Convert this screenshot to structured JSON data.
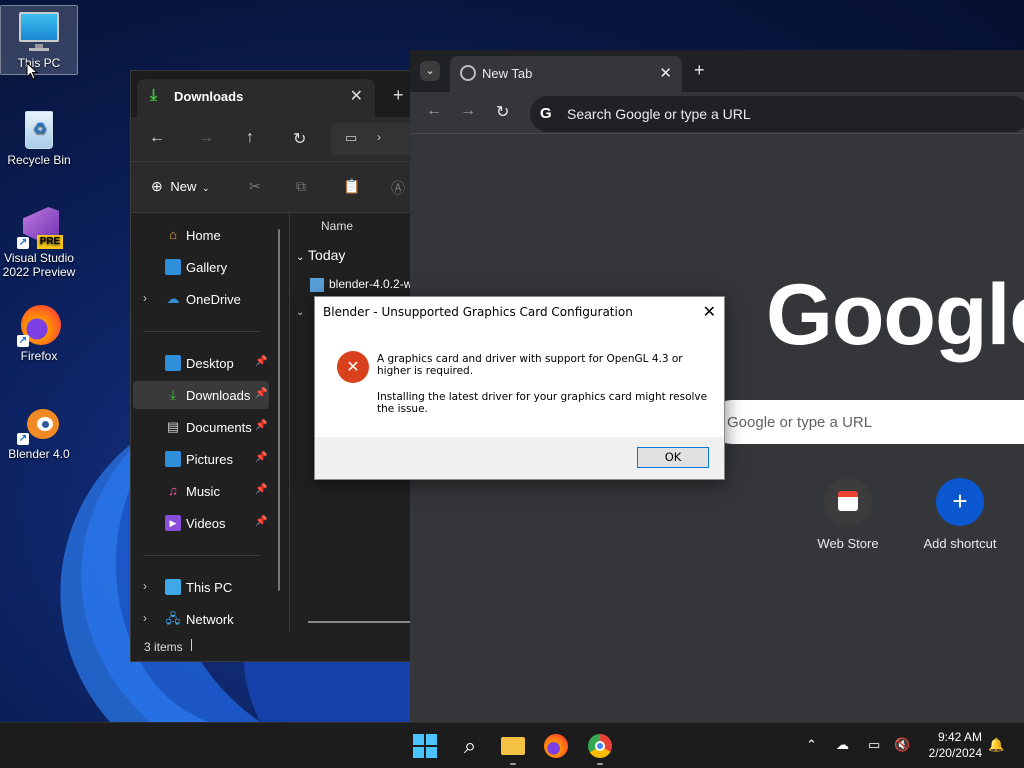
{
  "desktop": {
    "icons": [
      {
        "label": "This PC"
      },
      {
        "label": "Recycle Bin"
      },
      {
        "label": "Visual Studio 2022 Preview"
      },
      {
        "label": "Firefox"
      },
      {
        "label": "Blender 4.0"
      }
    ]
  },
  "explorer": {
    "tab_title": "Downloads",
    "toolbar": {
      "new_label": "New"
    },
    "sidebar": [
      {
        "label": "Home"
      },
      {
        "label": "Gallery"
      },
      {
        "label": "OneDrive"
      },
      {
        "label": "Desktop"
      },
      {
        "label": "Downloads"
      },
      {
        "label": "Documents"
      },
      {
        "label": "Pictures"
      },
      {
        "label": "Music"
      },
      {
        "label": "Videos"
      },
      {
        "label": "This PC"
      },
      {
        "label": "Network"
      }
    ],
    "content": {
      "column_name": "Name",
      "group_today": "Today",
      "file_1": "blender-4.0.2-w"
    },
    "status": "3 items"
  },
  "chrome": {
    "tab_title": "New Tab",
    "omnibox_placeholder": "Search Google or type a URL",
    "logo_text": "Google",
    "ntp_search_placeholder": "Google or type a URL",
    "shortcuts": [
      {
        "label": "Web Store"
      },
      {
        "label": "Add shortcut"
      }
    ]
  },
  "dialog": {
    "title": "Blender - Unsupported Graphics Card Configuration",
    "message_1": "A graphics card and driver with support for OpenGL 4.3 or higher is required.",
    "message_2": "Installing the latest driver for your graphics card might resolve the issue.",
    "ok_label": "OK"
  },
  "taskbar": {
    "time": "9:42 AM",
    "date": "2/20/2024"
  },
  "colors": {
    "error": "#d9401c",
    "accent": "#0078d7",
    "chrome_shortcut": "#0b57d0"
  }
}
